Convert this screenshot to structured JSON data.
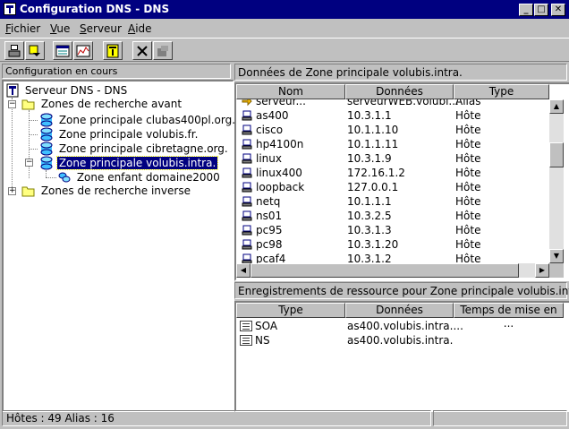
{
  "window": {
    "title": "Configuration DNS - DNS"
  },
  "menu": [
    {
      "label": "Fichier",
      "accel": "F",
      "rest": "ichier"
    },
    {
      "label": "Vue",
      "accel": "V",
      "rest": "ue"
    },
    {
      "label": "Serveur",
      "accel": "S",
      "rest": "erveur"
    },
    {
      "label": "Aide",
      "accel": "A",
      "rest": "ide"
    }
  ],
  "left": {
    "header": "Configuration en cours",
    "tree": {
      "root": "Serveur DNS - DNS",
      "forward": "Zones de recherche avant",
      "zones": [
        "Zone principale clubas400pl.org.",
        "Zone principale volubis.fr.",
        "Zone principale cibretagne.org.",
        "Zone principale volubis.intra."
      ],
      "child": "Zone enfant domaine2000",
      "reverse": "Zones de recherche inverse"
    }
  },
  "zone_panel": {
    "header": "Données de Zone principale volubis.intra.",
    "columns": [
      "Nom",
      "Données",
      "Type"
    ],
    "rows": [
      {
        "name": "serveur...",
        "data": "serveurWEB.volubi...",
        "type": "Alias"
      },
      {
        "name": "as400",
        "data": "10.3.1.1",
        "type": "Hôte"
      },
      {
        "name": "cisco",
        "data": "10.1.1.10",
        "type": "Hôte"
      },
      {
        "name": "hp4100n",
        "data": "10.1.1.11",
        "type": "Hôte"
      },
      {
        "name": "linux",
        "data": "10.3.1.9",
        "type": "Hôte"
      },
      {
        "name": "linux400",
        "data": "172.16.1.2",
        "type": "Hôte"
      },
      {
        "name": "loopback",
        "data": "127.0.0.1",
        "type": "Hôte"
      },
      {
        "name": "netq",
        "data": "10.1.1.1",
        "type": "Hôte"
      },
      {
        "name": "ns01",
        "data": "10.3.2.5",
        "type": "Hôte"
      },
      {
        "name": "pc95",
        "data": "10.3.1.3",
        "type": "Hôte"
      },
      {
        "name": "pc98",
        "data": "10.3.1.20",
        "type": "Hôte"
      },
      {
        "name": "pcaf4",
        "data": "10.3.1.2",
        "type": "Hôte"
      }
    ]
  },
  "records_panel": {
    "header": "Enregistrements de ressource pour  Zone principale volubis.intra.",
    "columns": [
      "Type",
      "Données",
      "Temps de mise en ..."
    ],
    "rows": [
      {
        "type": "SOA",
        "data": "as400.volubis.intra...."
      },
      {
        "type": "NS",
        "data": "as400.volubis.intra."
      }
    ]
  },
  "status": {
    "text": "Hôtes : 49  Alias : 16"
  },
  "colors": {
    "title_bg": "#000080",
    "face": "#c0c0c0",
    "selection": "#000080"
  },
  "icons": [
    "server-icon",
    "folder-icon",
    "zone-icon",
    "host-icon",
    "alias-icon",
    "record-icon"
  ]
}
